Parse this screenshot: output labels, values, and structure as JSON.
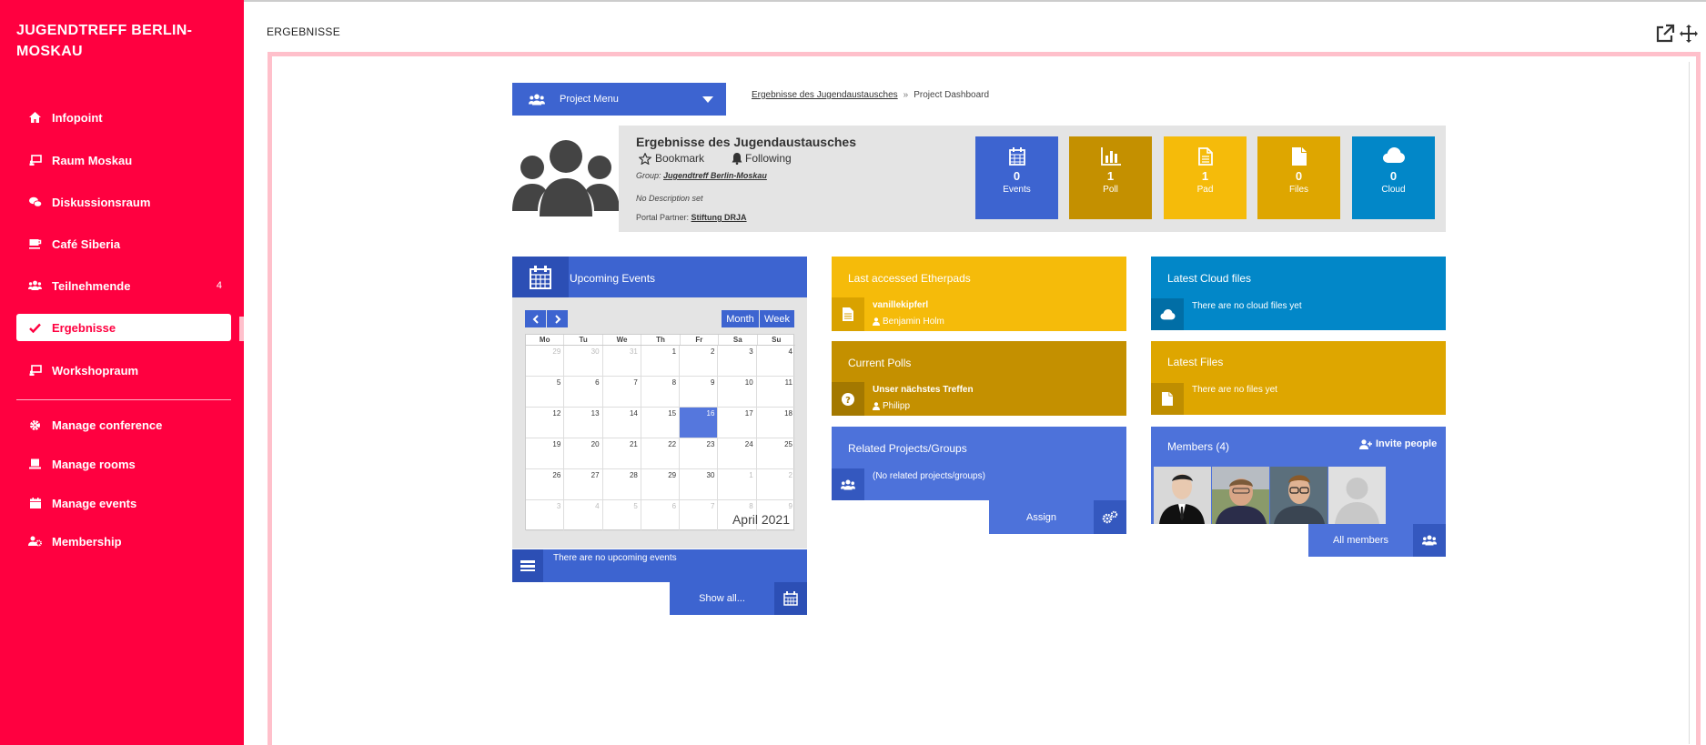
{
  "sidebar": {
    "brand": "JUGENDTREFF BERLIN-MOSKAU",
    "items": [
      {
        "label": "Infopoint",
        "icon": "home-icon",
        "count": ""
      },
      {
        "label": "Raum Moskau",
        "icon": "presentation-icon",
        "count": ""
      },
      {
        "label": "Diskussionsraum",
        "icon": "chat-bubbles-icon",
        "count": ""
      },
      {
        "label": "Café Siberia",
        "icon": "coffee-icon",
        "count": ""
      },
      {
        "label": "Teilnehmende",
        "icon": "users-icon",
        "count": "4"
      },
      {
        "label": "Ergebnisse",
        "icon": "check-icon",
        "count": ""
      },
      {
        "label": "Workshopraum",
        "icon": "presentation-icon",
        "count": ""
      }
    ],
    "admin_items": [
      {
        "label": "Manage conference",
        "icon": "gear-icon"
      },
      {
        "label": "Manage rooms",
        "icon": "room-icon"
      },
      {
        "label": "Manage events",
        "icon": "calendar-icon"
      },
      {
        "label": "Membership",
        "icon": "users-gear-icon"
      }
    ]
  },
  "page": {
    "title": "ERGEBNISSE"
  },
  "project_menu": {
    "label": "Project Menu"
  },
  "breadcrumb": {
    "parent": "Ergebnisse des Jugendaustausches",
    "separator": "»",
    "current": "Project Dashboard"
  },
  "project": {
    "title": "Ergebnisse des Jugendaustausches",
    "bookmark": "Bookmark",
    "following": "Following",
    "group_label": "Group:",
    "group_name": "Jugendtreff Berlin-Moskau",
    "description": "No Description set",
    "partner_label": "Portal Partner:",
    "partner_name": "Stiftung DRJA"
  },
  "stats": [
    {
      "count": "0",
      "label": "Events",
      "icon": "calendar-icon",
      "color": "#3d64d0"
    },
    {
      "count": "1",
      "label": "Poll",
      "icon": "bar-chart-icon",
      "color": "#c49000"
    },
    {
      "count": "1",
      "label": "Pad",
      "icon": "document-icon",
      "color": "#f5bb0a"
    },
    {
      "count": "0",
      "label": "Files",
      "icon": "file-icon",
      "color": "#dea600"
    },
    {
      "count": "0",
      "label": "Cloud",
      "icon": "cloud-icon",
      "color": "#0287c8"
    }
  ],
  "events": {
    "title": "Upcoming Events",
    "month_btn": "Month",
    "week_btn": "Week",
    "weekdays": [
      "Mo",
      "Tu",
      "We",
      "Th",
      "Fr",
      "Sa",
      "Su"
    ],
    "weeks": [
      [
        "29",
        "30",
        "31",
        "1",
        "2",
        "3",
        "4"
      ],
      [
        "5",
        "6",
        "7",
        "8",
        "9",
        "10",
        "11"
      ],
      [
        "12",
        "13",
        "14",
        "15",
        "16",
        "17",
        "18"
      ],
      [
        "19",
        "20",
        "21",
        "22",
        "23",
        "24",
        "25"
      ],
      [
        "26",
        "27",
        "28",
        "29",
        "30",
        "1",
        "2"
      ],
      [
        "3",
        "4",
        "5",
        "6",
        "7",
        "8",
        "9"
      ]
    ],
    "month_label": "April 2021",
    "empty_text": "There are no upcoming events",
    "show_all": "Show all..."
  },
  "etherpads": {
    "title": "Last accessed Etherpads",
    "item_title": "vanillekipferl",
    "item_author": "Benjamin Holm"
  },
  "polls": {
    "title": "Current Polls",
    "item_title": "Unser nächstes Treffen",
    "item_author": "Philipp"
  },
  "related": {
    "title": "Related Projects/Groups",
    "empty_text": "(No related projects/groups)",
    "assign": "Assign"
  },
  "cloud": {
    "title": "Latest Cloud files",
    "empty_text": "There are no cloud files yet"
  },
  "files": {
    "title": "Latest Files",
    "empty_text": "There are no files yet"
  },
  "members": {
    "title": "Members (4)",
    "invite": "Invite people",
    "all_members": "All members"
  }
}
